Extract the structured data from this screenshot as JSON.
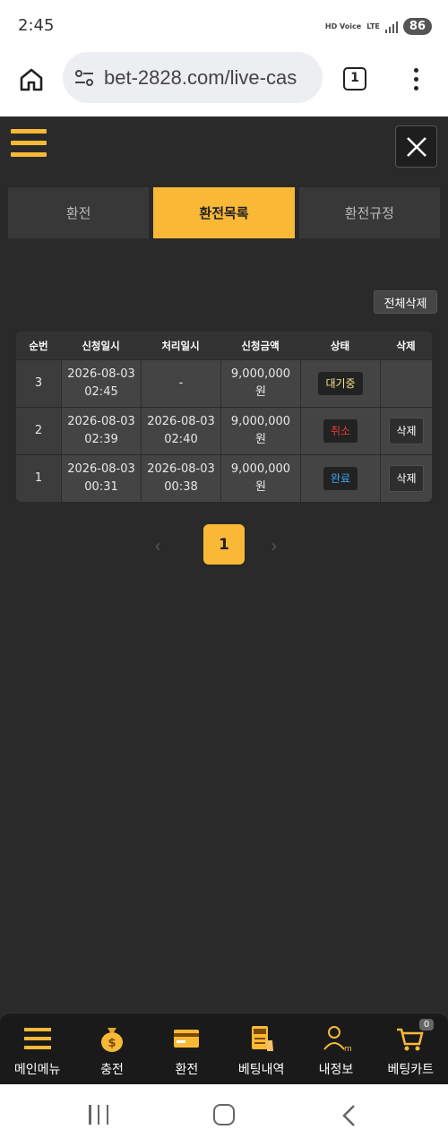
{
  "status_bar": {
    "time": "2:45",
    "hd_label": "HD Voice",
    "network": "LTE",
    "battery": "86"
  },
  "browser": {
    "url": "bet-2828.com/live-cas",
    "tab_count": "1"
  },
  "tabs": [
    {
      "label": "환전",
      "active": false
    },
    {
      "label": "환전목록",
      "active": true
    },
    {
      "label": "환전규정",
      "active": false
    }
  ],
  "delete_all_label": "전체삭제",
  "table": {
    "headers": [
      "순번",
      "신청일시",
      "처리일시",
      "신청금액",
      "상태",
      "삭제"
    ],
    "rows": [
      {
        "no": "3",
        "requested": "2026-08-03 02:45",
        "processed": "-",
        "amount": "9,000,000원",
        "status": "대기중",
        "delete": ""
      },
      {
        "no": "2",
        "requested": "2026-08-03 02:39",
        "processed": "2026-08-03 02:40",
        "amount": "9,000,000원",
        "status": "취소",
        "delete": "삭제"
      },
      {
        "no": "1",
        "requested": "2026-08-03 00:31",
        "processed": "2026-08-03 00:38",
        "amount": "9,000,000원",
        "status": "완료",
        "delete": "삭제"
      }
    ]
  },
  "pagination": {
    "prev": "‹",
    "current": "1",
    "next": "›"
  },
  "bottom_nav": [
    {
      "label": "메인메뉴",
      "icon": "menu-icon"
    },
    {
      "label": "충전",
      "icon": "money-bag-icon"
    },
    {
      "label": "환전",
      "icon": "card-icon"
    },
    {
      "label": "베팅내역",
      "icon": "bet-slip-icon"
    },
    {
      "label": "내정보",
      "icon": "user-icon"
    },
    {
      "label": "베팅카트",
      "icon": "cart-icon",
      "badge": "0"
    }
  ],
  "colors": {
    "accent": "#f9b937",
    "background": "#2a2a2a",
    "pending": "#f4e38c",
    "cancel": "#e63b3b",
    "done": "#3aa7f0"
  }
}
